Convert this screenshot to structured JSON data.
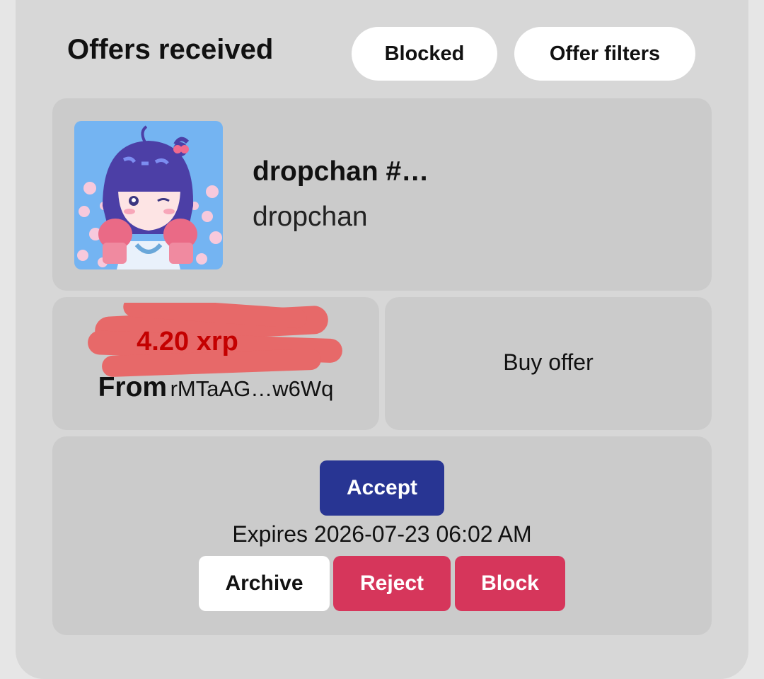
{
  "header": {
    "title": "Offers received",
    "blocked_label": "Blocked",
    "filters_label": "Offer filters"
  },
  "nft": {
    "name": "dropchan #…",
    "collection": "dropchan",
    "image_icon": "anime-girl-avatar-image"
  },
  "offer": {
    "amount": "4.20 xrp",
    "from_label": "From",
    "from_address": "rMTaAG…w6Wq",
    "type": "Buy offer",
    "expires": "Expires 2026-07-23 06:02 AM"
  },
  "actions": {
    "accept": "Accept",
    "archive": "Archive",
    "reject": "Reject",
    "block": "Block"
  },
  "colors": {
    "accept": "#283593",
    "danger": "#d6365b",
    "price": "#c40000",
    "card": "#cbcbcb",
    "panel": "#d7d7d7"
  }
}
